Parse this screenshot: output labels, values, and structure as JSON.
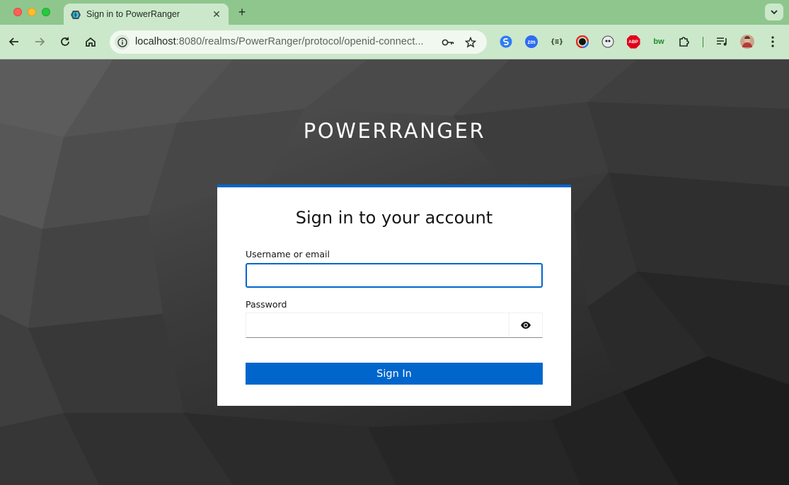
{
  "browser": {
    "tab": {
      "title": "Sign in to PowerRanger"
    },
    "address": {
      "host": "localhost",
      "path": ":8080/realms/PowerRanger/protocol/openid-connect..."
    },
    "extensions": [
      {
        "name": "extension-blue-s-icon",
        "text": ""
      },
      {
        "name": "zoom-extension-icon",
        "text": "zm"
      },
      {
        "name": "json-formatter-icon",
        "text": "{≡}"
      },
      {
        "name": "color-picker-icon",
        "text": ""
      },
      {
        "name": "ghost-extension-icon",
        "text": ""
      },
      {
        "name": "adblock-plus-icon",
        "text": "ABP"
      },
      {
        "name": "bitwarden-icon",
        "text": "bw"
      }
    ]
  },
  "login": {
    "realm_name": "POWERRANGER",
    "heading": "Sign in to your account",
    "username_label": "Username or email",
    "username_value": "",
    "password_label": "Password",
    "password_value": "",
    "submit_label": "Sign In"
  },
  "colors": {
    "brand_blue": "#0066cc",
    "chrome_green": "#8fc68e",
    "toolbar_green": "#cce8cb"
  }
}
